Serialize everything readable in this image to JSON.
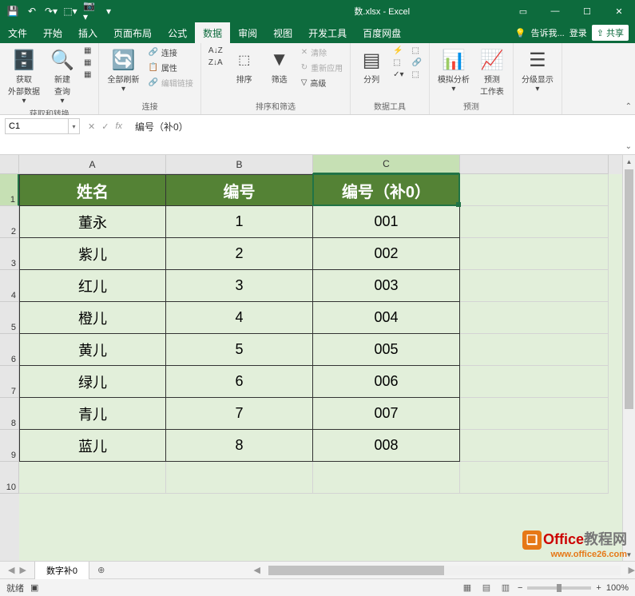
{
  "titlebar": {
    "title": "数.xlsx - Excel",
    "qat": {
      "save": "💾",
      "undo": "↶",
      "redo": "↷",
      "touch": "🔲",
      "snap": "📷"
    }
  },
  "menu": {
    "file": "文件",
    "home": "开始",
    "insert": "插入",
    "layout": "页面布局",
    "formula": "公式",
    "data": "数据",
    "review": "审阅",
    "view": "视图",
    "dev": "开发工具",
    "baidu": "百度网盘",
    "tellme": "告诉我...",
    "login": "登录",
    "share": "共享"
  },
  "ribbon": {
    "group1": {
      "label": "获取和转换",
      "btn1": "获取\n外部数据",
      "btn2": "新建\n查询"
    },
    "group2": {
      "label": "连接",
      "btn1": "全部刷新",
      "opt1": "连接",
      "opt2": "属性",
      "opt3": "编辑链接"
    },
    "group3": {
      "label": "排序和筛选",
      "sort": "排序",
      "filter": "筛选",
      "clear": "清除",
      "reapply": "重新应用",
      "advanced": "高级"
    },
    "group4": {
      "label": "数据工具",
      "btn": "分列"
    },
    "group5": {
      "label": "预测",
      "btn1": "模拟分析",
      "btn2": "预测\n工作表"
    },
    "group6": {
      "label": "",
      "btn": "分级显示"
    }
  },
  "namebox": "C1",
  "formula": "编号（补0）",
  "columns": [
    "A",
    "B",
    "C"
  ],
  "headers": {
    "a": "姓名",
    "b": "编号",
    "c": "编号（补0）"
  },
  "rows": [
    {
      "a": "董永",
      "b": "1",
      "c": "001"
    },
    {
      "a": "紫儿",
      "b": "2",
      "c": "002"
    },
    {
      "a": "红儿",
      "b": "3",
      "c": "003"
    },
    {
      "a": "橙儿",
      "b": "4",
      "c": "004"
    },
    {
      "a": "黄儿",
      "b": "5",
      "c": "005"
    },
    {
      "a": "绿儿",
      "b": "6",
      "c": "006"
    },
    {
      "a": "青儿",
      "b": "7",
      "c": "007"
    },
    {
      "a": "蓝儿",
      "b": "8",
      "c": "008"
    }
  ],
  "sheet": {
    "name": "数字补0"
  },
  "status": {
    "ready": "就绪",
    "zoom": "100%"
  },
  "watermark": {
    "t1": "Office",
    "t2": "教程网",
    "url": "www.office26.com"
  }
}
